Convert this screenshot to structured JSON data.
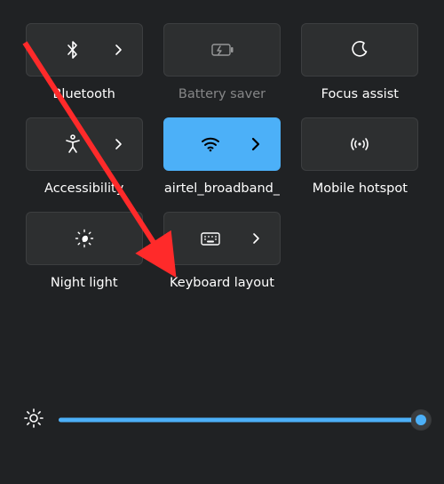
{
  "tiles": {
    "bluetooth": {
      "label": "Bluetooth",
      "active": false,
      "has_chevron": true,
      "dim": false
    },
    "battery_saver": {
      "label": "Battery saver",
      "active": false,
      "has_chevron": false,
      "dim": true
    },
    "focus_assist": {
      "label": "Focus assist",
      "active": false,
      "has_chevron": false,
      "dim": false
    },
    "accessibility": {
      "label": "Accessibility",
      "active": false,
      "has_chevron": true,
      "dim": false
    },
    "wifi": {
      "label": "airtel_broadband_",
      "active": true,
      "has_chevron": true,
      "dim": false
    },
    "mobile_hotspot": {
      "label": "Mobile hotspot",
      "active": false,
      "has_chevron": false,
      "dim": false
    },
    "night_light": {
      "label": "Night light",
      "active": false,
      "has_chevron": false,
      "dim": false
    },
    "keyboard_layout": {
      "label": "Keyboard layout",
      "active": false,
      "has_chevron": true,
      "dim": false
    }
  },
  "brightness": {
    "value_percent": 100
  },
  "annotation": {
    "arrow_points_to": "keyboard-layout-tile"
  },
  "colors": {
    "accent": "#4cb0f8",
    "bg": "#202224",
    "arrow": "#ff2a2a"
  }
}
